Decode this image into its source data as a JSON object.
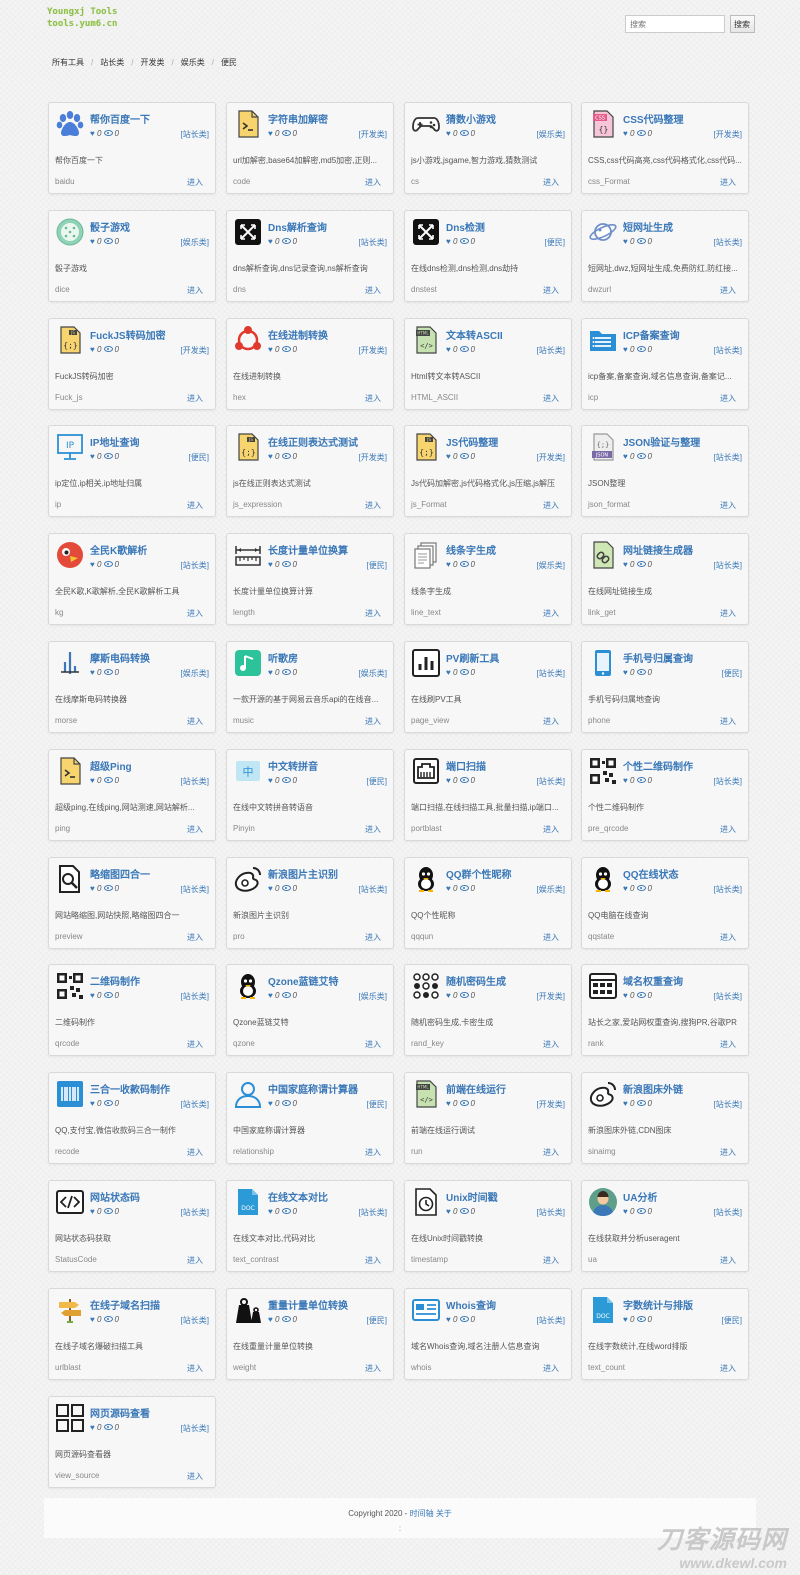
{
  "header": {
    "logo_line1": "Youngxj Tools",
    "logo_line2": "tools.yum6.cn",
    "search_placeholder": "搜索",
    "search_button": "搜索"
  },
  "breadcrumb": [
    "所有工具",
    "站长类",
    "开发类",
    "娱乐类",
    "便民"
  ],
  "card_enter_label": "进入",
  "cards": [
    {
      "title": "帮你百度一下",
      "likes": "0",
      "views": "0",
      "category": "[站长类]",
      "desc": "帮你百度一下",
      "slug": "baidu",
      "icon": "paw-icon"
    },
    {
      "title": "字符串加解密",
      "likes": "0",
      "views": "0",
      "category": "[开发类]",
      "desc": "url加解密,base64加解密,md5加密,正则...",
      "slug": "code",
      "icon": "terminal-file-icon"
    },
    {
      "title": "猜数小游戏",
      "likes": "0",
      "views": "0",
      "category": "[娱乐类]",
      "desc": "js小游戏,jsgame,智力游戏,猜数测试",
      "slug": "cs",
      "icon": "gamepad-icon"
    },
    {
      "title": "CSS代码整理",
      "likes": "0",
      "views": "0",
      "category": "[开发类]",
      "desc": "CSS,css代码高亮,css代码格式化,css代码...",
      "slug": "css_Format",
      "icon": "css-file-icon"
    },
    {
      "title": "骰子游戏",
      "likes": "0",
      "views": "0",
      "category": "[娱乐类]",
      "desc": "骰子游戏",
      "slug": "dice",
      "icon": "dice-icon"
    },
    {
      "title": "Dns解析查询",
      "likes": "0",
      "views": "0",
      "category": "[站长类]",
      "desc": "dns解析查询,dns记录查询,ns解析查询",
      "slug": "dns",
      "icon": "dns-icon"
    },
    {
      "title": "Dns检测",
      "likes": "0",
      "views": "0",
      "category": "[便民]",
      "desc": "在线dns检测,dns检测,dns劫持",
      "slug": "dnstest",
      "icon": "dns-icon"
    },
    {
      "title": "短网址生成",
      "likes": "0",
      "views": "0",
      "category": "[站长类]",
      "desc": "短网址,dwz,短网址生成,免费防红,防红接...",
      "slug": "dwzurl",
      "icon": "planet-icon"
    },
    {
      "title": "FuckJS转码加密",
      "likes": "0",
      "views": "0",
      "category": "[开发类]",
      "desc": "FuckJS转码加密",
      "slug": "Fuck_js",
      "icon": "js-file-icon"
    },
    {
      "title": "在线进制转换",
      "likes": "0",
      "views": "0",
      "category": "[开发类]",
      "desc": "在线进制转换",
      "slug": "hex",
      "icon": "network-icon"
    },
    {
      "title": "文本转ASCII",
      "likes": "0",
      "views": "0",
      "category": "[站长类]",
      "desc": "Html转文本转ASCII",
      "slug": "HTML_ASCII",
      "icon": "html-file-icon"
    },
    {
      "title": "ICP备案查询",
      "likes": "0",
      "views": "0",
      "category": "[站长类]",
      "desc": "icp备案,备案查询,域名信息查询,备案记...",
      "slug": "icp",
      "icon": "folder-list-icon"
    },
    {
      "title": "IP地址查询",
      "likes": "0",
      "views": "0",
      "category": "[便民]",
      "desc": "ip定位,ip相关,ip地址归属",
      "slug": "ip",
      "icon": "ip-monitor-icon"
    },
    {
      "title": "在线正则表达式测试",
      "likes": "0",
      "views": "0",
      "category": "[开发类]",
      "desc": "js在线正则表达式测试",
      "slug": "js_expression",
      "icon": "js-file-icon"
    },
    {
      "title": "JS代码整理",
      "likes": "0",
      "views": "0",
      "category": "[开发类]",
      "desc": "Js代码加解密,js代码格式化,js压缩,js解压",
      "slug": "js_Format",
      "icon": "js-file-icon"
    },
    {
      "title": "JSON验证与整理",
      "likes": "0",
      "views": "0",
      "category": "[站长类]",
      "desc": "JSON整理",
      "slug": "json_format",
      "icon": "json-file-icon"
    },
    {
      "title": "全民K歌解析",
      "likes": "0",
      "views": "0",
      "category": "[站长类]",
      "desc": "全民K歌,K歌解析,全民K歌解析工具",
      "slug": "kg",
      "icon": "bird-icon"
    },
    {
      "title": "长度计量单位换算",
      "likes": "0",
      "views": "0",
      "category": "[便民]",
      "desc": "长度计量单位换算计算",
      "slug": "length",
      "icon": "ruler-icon"
    },
    {
      "title": "线条字生成",
      "likes": "0",
      "views": "0",
      "category": "[娱乐类]",
      "desc": "线条字生成",
      "slug": "line_text",
      "icon": "documents-icon"
    },
    {
      "title": "网址链接生成器",
      "likes": "0",
      "views": "0",
      "category": "[站长类]",
      "desc": "在线网址链接生成",
      "slug": "link_get",
      "icon": "link-file-icon"
    },
    {
      "title": "摩斯电码转换",
      "likes": "0",
      "views": "0",
      "category": "[娱乐类]",
      "desc": "在线摩斯电码转换器",
      "slug": "morse",
      "icon": "morse-icon"
    },
    {
      "title": "听歌房",
      "likes": "0",
      "views": "0",
      "category": "[娱乐类]",
      "desc": "一款开源的基于网易云音乐api的在线音...",
      "slug": "music",
      "icon": "music-icon"
    },
    {
      "title": "PV刷新工具",
      "likes": "0",
      "views": "0",
      "category": "[站长类]",
      "desc": "在线刷PV工具",
      "slug": "page_view",
      "icon": "bar-chart-icon"
    },
    {
      "title": "手机号归属查询",
      "likes": "0",
      "views": "0",
      "category": "[便民]",
      "desc": "手机号码归属地查询",
      "slug": "phone",
      "icon": "phone-icon"
    },
    {
      "title": "超级Ping",
      "likes": "0",
      "views": "0",
      "category": "[站长类]",
      "desc": "超级ping,在线ping,网站测速,网站解析...",
      "slug": "ping",
      "icon": "terminal-file-icon"
    },
    {
      "title": "中文转拼音",
      "likes": "0",
      "views": "0",
      "category": "[便民]",
      "desc": "在线中文转拼音转语音",
      "slug": "Pinyin",
      "icon": "chinese-icon"
    },
    {
      "title": "端口扫描",
      "likes": "0",
      "views": "0",
      "category": "[站长类]",
      "desc": "端口扫描,在线扫描工具,批量扫描,ip端口...",
      "slug": "portblast",
      "icon": "ethernet-icon"
    },
    {
      "title": "个性二维码制作",
      "likes": "0",
      "views": "0",
      "category": "[站长类]",
      "desc": "个性二维码制作",
      "slug": "pre_qrcode",
      "icon": "qrcode-icon"
    },
    {
      "title": "略缩图四合一",
      "likes": "0",
      "views": "0",
      "category": "[站长类]",
      "desc": "网站略缩图,网站快照,略缩图四合一",
      "slug": "preview",
      "icon": "search-file-icon"
    },
    {
      "title": "新浪图片主识别",
      "likes": "0",
      "views": "0",
      "category": "[站长类]",
      "desc": "新浪图片主识别",
      "slug": "pro",
      "icon": "weibo-icon"
    },
    {
      "title": "QQ群个性昵称",
      "likes": "0",
      "views": "0",
      "category": "[娱乐类]",
      "desc": "QQ个性昵称",
      "slug": "qqqun",
      "icon": "penguin-icon"
    },
    {
      "title": "QQ在线状态",
      "likes": "0",
      "views": "0",
      "category": "[站长类]",
      "desc": "QQ电脑在线查询",
      "slug": "qqstate",
      "icon": "penguin-icon"
    },
    {
      "title": "二维码制作",
      "likes": "0",
      "views": "0",
      "category": "[站长类]",
      "desc": "二维码制作",
      "slug": "qrcode",
      "icon": "qrcode-icon"
    },
    {
      "title": "Qzone蓝链艾特",
      "likes": "0",
      "views": "0",
      "category": "[娱乐类]",
      "desc": "Qzone蓝链艾特",
      "slug": "qzone",
      "icon": "penguin-icon"
    },
    {
      "title": "随机密码生成",
      "likes": "0",
      "views": "0",
      "category": "[开发类]",
      "desc": "随机密码生成,卡密生成",
      "slug": "rand_key",
      "icon": "dots-grid-icon"
    },
    {
      "title": "域名权重查询",
      "likes": "0",
      "views": "0",
      "category": "[站长类]",
      "desc": "站长之家,爱站网权重查询,搜狗PR,谷歌PR",
      "slug": "rank",
      "icon": "browser-icon"
    },
    {
      "title": "三合一收款码制作",
      "likes": "0",
      "views": "0",
      "category": "[站长类]",
      "desc": "QQ,支付宝,微信收款码三合一制作",
      "slug": "recode",
      "icon": "barcode-icon"
    },
    {
      "title": "中国家庭称谓计算器",
      "likes": "0",
      "views": "0",
      "category": "[便民]",
      "desc": "中国家庭称谓计算器",
      "slug": "relationship",
      "icon": "user-icon"
    },
    {
      "title": "前端在线运行",
      "likes": "0",
      "views": "0",
      "category": "[开发类]",
      "desc": "前端在线运行调试",
      "slug": "run",
      "icon": "html-file-icon"
    },
    {
      "title": "新浪图床外链",
      "likes": "0",
      "views": "0",
      "category": "[站长类]",
      "desc": "新浪图床外链,CDN图床",
      "slug": "sinaimg",
      "icon": "weibo-icon"
    },
    {
      "title": "网站状态码",
      "likes": "0",
      "views": "0",
      "category": "[站长类]",
      "desc": "网站状态码获取",
      "slug": "StatusCode",
      "icon": "code-icon"
    },
    {
      "title": "在线文本对比",
      "likes": "0",
      "views": "0",
      "category": "[站长类]",
      "desc": "在线文本对比,代码对比",
      "slug": "text_contrast",
      "icon": "doc-file-icon"
    },
    {
      "title": "Unix时间戳",
      "likes": "0",
      "views": "0",
      "category": "[站长类]",
      "desc": "在线Unix时间戳转换",
      "slug": "timestamp",
      "icon": "clock-file-icon"
    },
    {
      "title": "UA分析",
      "likes": "0",
      "views": "0",
      "category": "[站长类]",
      "desc": "在线获取并分析useragent",
      "slug": "ua",
      "icon": "avatar-icon"
    },
    {
      "title": "在线子域名扫描",
      "likes": "0",
      "views": "0",
      "category": "[站长类]",
      "desc": "在线子域名爆破扫描工具",
      "slug": "urlblast",
      "icon": "signpost-icon"
    },
    {
      "title": "重量计量单位转换",
      "likes": "0",
      "views": "0",
      "category": "[便民]",
      "desc": "在线重量计量单位转换",
      "slug": "weight",
      "icon": "weight-icon"
    },
    {
      "title": "Whois查询",
      "likes": "0",
      "views": "0",
      "category": "[站长类]",
      "desc": "域名Whois查询,域名注册人信息查询",
      "slug": "whois",
      "icon": "id-card-icon"
    },
    {
      "title": "字数统计与排版",
      "likes": "0",
      "views": "0",
      "category": "[便民]",
      "desc": "在线字数统计,在线word排版",
      "slug": "text_count",
      "icon": "doc-file-icon"
    },
    {
      "title": "网页源码查看",
      "likes": "0",
      "views": "0",
      "category": "[站长类]",
      "desc": "网页源码查看器",
      "slug": "view_source",
      "icon": "grid-squares-icon"
    }
  ],
  "footer": {
    "copyright": "Copyright 2020 -",
    "link1": "时间轴",
    "link2": "关于",
    "dot": ":"
  },
  "watermark": {
    "line1": "刀客源码网",
    "line2": "www.dkewl.com"
  },
  "colors": {
    "accent": "#3a78b8",
    "logo": "#8fbf4a"
  }
}
